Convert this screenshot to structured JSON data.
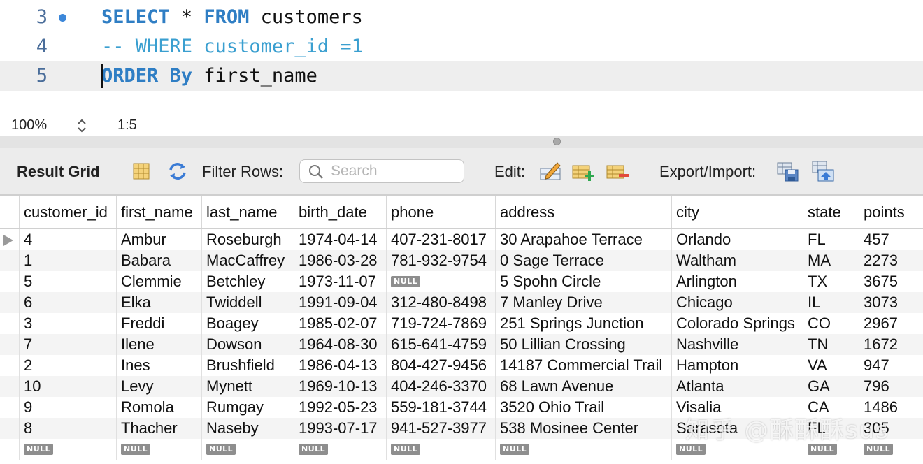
{
  "editor": {
    "lines": [
      {
        "number": "3",
        "kw1": "SELECT",
        "text1": " * ",
        "kw2": "FROM",
        "text2": " customers",
        "breakpoint": true
      },
      {
        "number": "4",
        "comment": "-- WHERE customer_id =1"
      },
      {
        "number": "5",
        "kw1": "ORDER By",
        "text1": " first_name",
        "current": true
      }
    ]
  },
  "status": {
    "zoom": "100%",
    "cursor_position": "1:5"
  },
  "toolbar": {
    "title": "Result Grid",
    "filter_label": "Filter Rows:",
    "search_placeholder": "Search",
    "edit_label": "Edit:",
    "export_label": "Export/Import:",
    "icons": [
      "grid-layout-icon",
      "refresh-icon",
      "search-icon",
      "edit-cell-icon",
      "add-row-icon",
      "delete-row-icon",
      "export-icon",
      "import-icon"
    ]
  },
  "grid": {
    "columns": [
      "customer_id",
      "first_name",
      "last_name",
      "birth_date",
      "phone",
      "address",
      "city",
      "state",
      "points"
    ],
    "rows": [
      [
        "4",
        "Ambur",
        "Roseburgh",
        "1974-04-14",
        "407-231-8017",
        "30 Arapahoe Terrace",
        "Orlando",
        "FL",
        "457"
      ],
      [
        "1",
        "Babara",
        "MacCaffrey",
        "1986-03-28",
        "781-932-9754",
        "0 Sage Terrace",
        "Waltham",
        "MA",
        "2273"
      ],
      [
        "5",
        "Clemmie",
        "Betchley",
        "1973-11-07",
        "NULL",
        "5 Spohn Circle",
        "Arlington",
        "TX",
        "3675"
      ],
      [
        "6",
        "Elka",
        "Twiddell",
        "1991-09-04",
        "312-480-8498",
        "7 Manley Drive",
        "Chicago",
        "IL",
        "3073"
      ],
      [
        "3",
        "Freddi",
        "Boagey",
        "1985-02-07",
        "719-724-7869",
        "251 Springs Junction",
        "Colorado Springs",
        "CO",
        "2967"
      ],
      [
        "7",
        "Ilene",
        "Dowson",
        "1964-08-30",
        "615-641-4759",
        "50 Lillian Crossing",
        "Nashville",
        "TN",
        "1672"
      ],
      [
        "2",
        "Ines",
        "Brushfield",
        "1986-04-13",
        "804-427-9456",
        "14187 Commercial Trail",
        "Hampton",
        "VA",
        "947"
      ],
      [
        "10",
        "Levy",
        "Mynett",
        "1969-10-13",
        "404-246-3370",
        "68 Lawn Avenue",
        "Atlanta",
        "GA",
        "796"
      ],
      [
        "9",
        "Romola",
        "Rumgay",
        "1992-05-23",
        "559-181-3744",
        "3520 Ohio Trail",
        "Visalia",
        "CA",
        "1486"
      ],
      [
        "8",
        "Thacher",
        "Naseby",
        "1993-07-17",
        "941-527-3977",
        "538 Mosinee Center",
        "Sarasota",
        "FL",
        "305"
      ],
      [
        "NULL",
        "NULL",
        "NULL",
        "NULL",
        "NULL",
        "NULL",
        "NULL",
        "NULL",
        "NULL"
      ]
    ],
    "null_text": "NULL"
  },
  "watermark": "知乎 @酥酥酥sus"
}
